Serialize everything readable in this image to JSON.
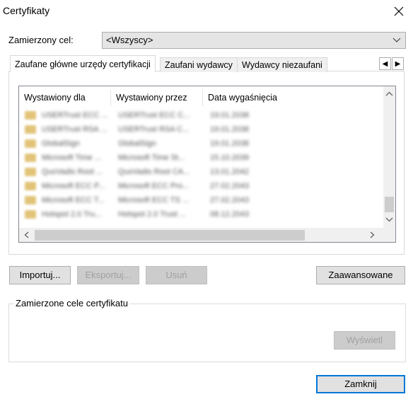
{
  "window": {
    "title": "Certyfikaty",
    "close_glyph": "✕"
  },
  "purpose": {
    "label": "Zamierzony cel:",
    "value": "<Wszyscy>"
  },
  "tabs": [
    {
      "label": "Zaufane główne urzędy certyfikacji"
    },
    {
      "label": "Zaufani wydawcy"
    },
    {
      "label": "Wydawcy niezaufani"
    }
  ],
  "tab_scroll": {
    "left": "◂",
    "right": "▸"
  },
  "table": {
    "columns": [
      "Wystawiony dla",
      "Wystawiony przez",
      "Data wygaśnięcia"
    ],
    "rows": [
      [
        "USERTrust ECC ...",
        "USERTrust ECC C...",
        "19.01.2038"
      ],
      [
        "USERTrust RSA ...",
        "USERTrust RSA C...",
        "19.01.2038"
      ],
      [
        "GlobalSign",
        "GlobalSign",
        "19.01.2038"
      ],
      [
        "Microsoft Time ...",
        "Microsoft Time St...",
        "15.10.2039"
      ],
      [
        "QuoVadis Root ...",
        "QuoVadis Root CA...",
        "13.01.2042"
      ],
      [
        "Microsoft ECC P...",
        "Microsoft ECC Pro...",
        "27.02.2043"
      ],
      [
        "Microsoft ECC T...",
        "Microsoft ECC TS ...",
        "27.02.2043"
      ],
      [
        "Hotspot 2.0 Tru...",
        "Hotspot 2.0 Trust ...",
        "08.12.2043"
      ]
    ]
  },
  "buttons": {
    "import": "Importuj...",
    "export": "Eksportuj...",
    "remove": "Usuń",
    "advanced": "Zaawansowane",
    "view": "Wyświetl",
    "close": "Zamknij"
  },
  "group": {
    "label": "Zamierzone cele certyfikatu"
  },
  "colors": {
    "accent": "#0078d7",
    "disabled_bg": "#cccccc",
    "button_bg": "#e1e1e1"
  }
}
